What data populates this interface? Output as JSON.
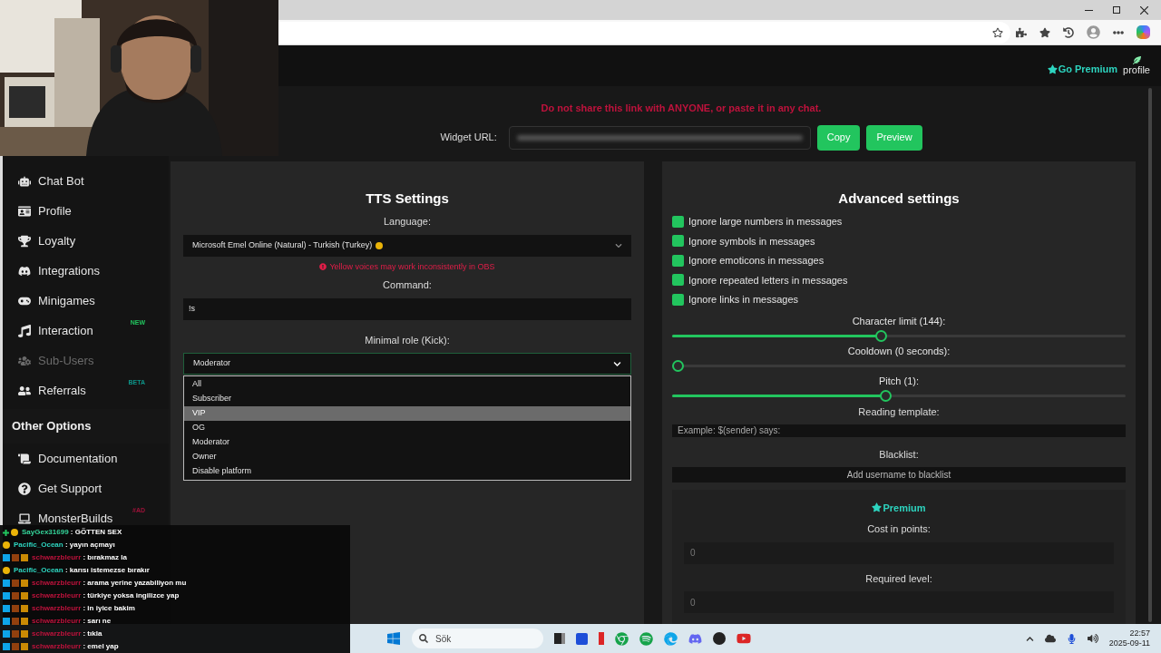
{
  "header": {
    "premium": "Go Premium",
    "profile": "profile"
  },
  "warning": "Do not share this link with ANYONE, or paste it in any chat.",
  "widget": {
    "label": "Widget URL:",
    "buttons": [
      "Copy",
      "Preview"
    ]
  },
  "sidebar": {
    "items": [
      {
        "label": "Chat Bot",
        "disabled": false
      },
      {
        "label": "Profile",
        "disabled": false
      },
      {
        "label": "Loyalty",
        "disabled": false
      },
      {
        "label": "Integrations",
        "disabled": false
      },
      {
        "label": "Minigames",
        "disabled": false
      },
      {
        "label": "Interaction",
        "disabled": false,
        "badge": {
          "text": "NEW",
          "kind": "new"
        }
      },
      {
        "label": "Sub-Users",
        "disabled": true
      },
      {
        "label": "Referrals",
        "disabled": false,
        "badge": {
          "text": "BETA",
          "kind": "beta"
        }
      }
    ],
    "section": "Other Options",
    "other_items": [
      {
        "label": "Documentation",
        "disabled": false
      },
      {
        "label": "Get Support",
        "disabled": false
      },
      {
        "label": "MonsterBuilds",
        "disabled": false,
        "badge": {
          "text": "#AD",
          "kind": "ad"
        }
      }
    ]
  },
  "tts": {
    "title": "TTS Settings",
    "language_label": "Language:",
    "language": "Microsoft Emel Online (Natural) - Turkish (Turkey)",
    "voice_warning": "Yellow voices may work inconsistently in OBS",
    "command_label": "Command:",
    "command": "!s",
    "role_label": "Minimal role (Kick):",
    "role": "Moderator",
    "role_options": [
      {
        "label": "All",
        "highlighted": false
      },
      {
        "label": "Subscriber",
        "highlighted": false
      },
      {
        "label": "VIP",
        "highlighted": true
      },
      {
        "label": "OG",
        "highlighted": false
      },
      {
        "label": "Moderator",
        "highlighted": false
      },
      {
        "label": "Owner",
        "highlighted": false
      },
      {
        "label": "Disable platform",
        "highlighted": false
      }
    ]
  },
  "advanced": {
    "title": "Advanced settings",
    "options": [
      {
        "label": "Ignore large numbers in messages",
        "checked": true
      },
      {
        "label": "Ignore symbols in messages",
        "checked": true
      },
      {
        "label": "Ignore emoticons in messages",
        "checked": true
      },
      {
        "label": "Ignore repeated letters in messages",
        "checked": true
      },
      {
        "label": "Ignore links in messages",
        "checked": true
      }
    ],
    "sliders": [
      {
        "label": "Character limit (144):",
        "level": 0.46
      },
      {
        "label": "Cooldown (0 seconds):",
        "level": 0
      },
      {
        "label": "Pitch (1):",
        "level": 0.47
      }
    ],
    "template_label": "Reading template:",
    "template_placeholder": "Example: $(sender) says:",
    "blacklist_label": "Blacklist:",
    "blacklist_placeholder": "Add username to blacklist",
    "premium": {
      "title": "Premium",
      "cost_label": "Cost in points:",
      "cost_placeholder": "0",
      "level_label": "Required level:",
      "level_placeholder": "0"
    }
  },
  "chat": [
    {
      "badges": [
        {
          "kind": "plus"
        },
        {
          "kind": "coin"
        }
      ],
      "user": "SayGex31699",
      "color": "#34d399",
      "text": ": GÖTTEN SEX"
    },
    {
      "badges": [
        {
          "kind": "coin"
        }
      ],
      "user": "Pacific_Ocean",
      "color": "#2dd4bf",
      "text": ": yayın açmayı"
    },
    {
      "badges": [
        {
          "kind": "mod"
        },
        {
          "kind": "sub"
        },
        {
          "kind": "crown"
        }
      ],
      "user": "schwarzbleurr",
      "color": "#be123c",
      "text": ": bırakmaz la"
    },
    {
      "badges": [
        {
          "kind": "coin"
        }
      ],
      "user": "Pacific_Ocean",
      "color": "#2dd4bf",
      "text": ": karısı istemezse bırakır"
    },
    {
      "badges": [
        {
          "kind": "mod"
        },
        {
          "kind": "sub"
        },
        {
          "kind": "crown"
        }
      ],
      "user": "schwarzbleurr",
      "color": "#be123c",
      "text": ": arama yerine yazabiliyon mu"
    },
    {
      "badges": [
        {
          "kind": "mod"
        },
        {
          "kind": "sub"
        },
        {
          "kind": "crown"
        }
      ],
      "user": "schwarzbleurr",
      "color": "#be123c",
      "text": ": türkiye yoksa ingilizce yap"
    },
    {
      "badges": [
        {
          "kind": "mod"
        },
        {
          "kind": "sub"
        },
        {
          "kind": "crown"
        }
      ],
      "user": "schwarzbleurr",
      "color": "#be123c",
      "text": ": in iyice bakim"
    },
    {
      "badges": [
        {
          "kind": "mod"
        },
        {
          "kind": "sub"
        },
        {
          "kind": "crown"
        }
      ],
      "user": "schwarzbleurr",
      "color": "#be123c",
      "text": ": sarı ne"
    },
    {
      "badges": [
        {
          "kind": "mod"
        },
        {
          "kind": "sub"
        },
        {
          "kind": "crown"
        }
      ],
      "user": "schwarzbleurr",
      "color": "#be123c",
      "text": ": tıkla"
    },
    {
      "badges": [
        {
          "kind": "mod"
        },
        {
          "kind": "sub"
        },
        {
          "kind": "crown"
        }
      ],
      "user": "schwarzbleurr",
      "color": "#be123c",
      "text": ": emel yap"
    }
  ],
  "taskbar": {
    "search": "Sök",
    "time": "22:57",
    "date": "2025-09-11"
  }
}
